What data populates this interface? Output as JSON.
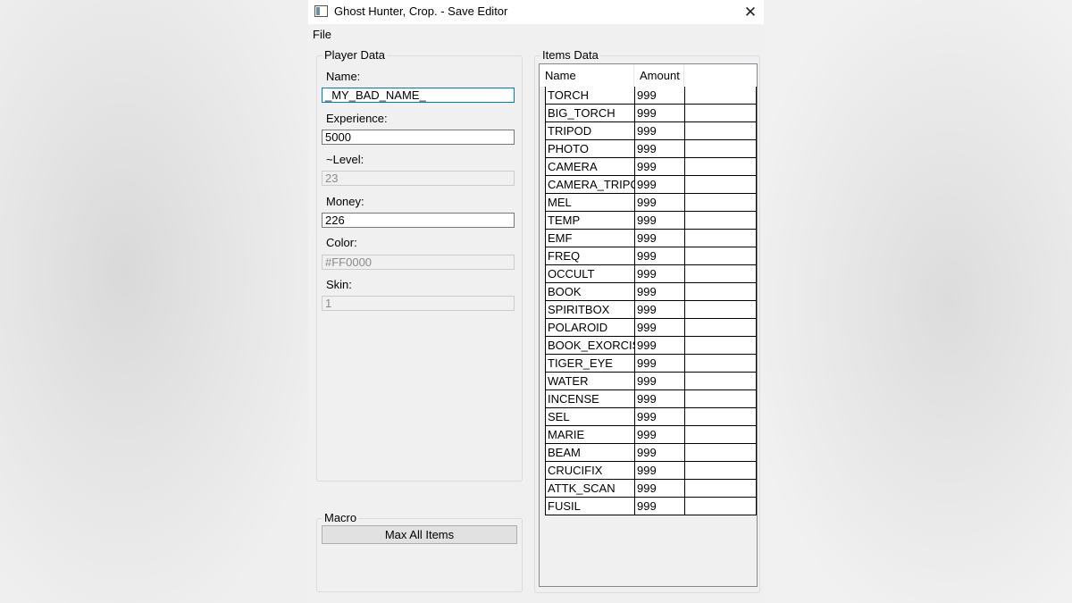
{
  "window": {
    "title": "Ghost Hunter, Crop. - Save Editor",
    "close_glyph": "✕"
  },
  "menu": {
    "file": "File"
  },
  "player": {
    "legend": "Player Data",
    "name_label": "Name:",
    "name_value": "_MY_BAD_NAME_",
    "experience_label": "Experience:",
    "experience_value": "5000",
    "level_label": "~Level:",
    "level_value": "23",
    "money_label": "Money:",
    "money_value": "226",
    "color_label": "Color:",
    "color_value": "#FF0000",
    "skin_label": "Skin:",
    "skin_value": "1"
  },
  "macro": {
    "legend": "Macro",
    "max_all_label": "Max All Items"
  },
  "items": {
    "legend": "Items Data",
    "columns": [
      "Name",
      "Amount"
    ],
    "rows": [
      {
        "name": "TORCH",
        "amount": "999"
      },
      {
        "name": "BIG_TORCH",
        "amount": "999"
      },
      {
        "name": "TRIPOD",
        "amount": "999"
      },
      {
        "name": "PHOTO",
        "amount": "999"
      },
      {
        "name": "CAMERA",
        "amount": "999"
      },
      {
        "name": "CAMERA_TRIPOD",
        "amount": "999"
      },
      {
        "name": "MEL",
        "amount": "999"
      },
      {
        "name": "TEMP",
        "amount": "999"
      },
      {
        "name": "EMF",
        "amount": "999"
      },
      {
        "name": "FREQ",
        "amount": "999"
      },
      {
        "name": "OCCULT",
        "amount": "999"
      },
      {
        "name": "BOOK",
        "amount": "999"
      },
      {
        "name": "SPIRITBOX",
        "amount": "999"
      },
      {
        "name": "POLAROID",
        "amount": "999"
      },
      {
        "name": "BOOK_EXORCISM",
        "amount": "999"
      },
      {
        "name": "TIGER_EYE",
        "amount": "999"
      },
      {
        "name": "WATER",
        "amount": "999"
      },
      {
        "name": "INCENSE",
        "amount": "999"
      },
      {
        "name": "SEL",
        "amount": "999"
      },
      {
        "name": "MARIE",
        "amount": "999"
      },
      {
        "name": "BEAM",
        "amount": "999"
      },
      {
        "name": "CRUCIFIX",
        "amount": "999"
      },
      {
        "name": "ATTK_SCAN",
        "amount": "999"
      },
      {
        "name": "FUSIL",
        "amount": "999"
      }
    ]
  },
  "icons": {
    "app": "app-window-icon",
    "close": "close-icon"
  },
  "colors": {
    "focus_border": "#0078d7",
    "window_bg": "#f0f0f0",
    "disabled_text": "#8a8a8a"
  }
}
